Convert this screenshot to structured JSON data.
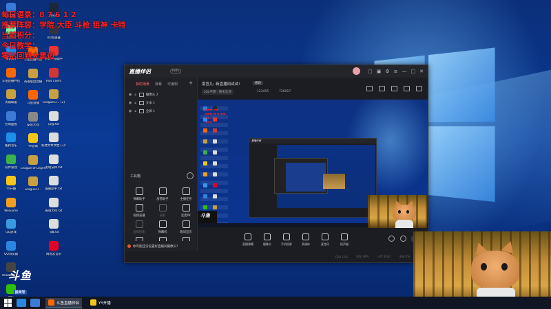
{
  "overlay_text": {
    "line1": "每日语录：8 7 6 1 2",
    "line2": "推荐阵容：学院 大臣 斗枪 狙神 卡特",
    "line3": "当前积分：",
    "line4": "今日教学：",
    "line5": "零钻回到大黑边"
  },
  "desktop_icons": [
    {
      "label": "此电脑",
      "color": "#3a7bd5"
    },
    {
      "label": "回收站",
      "color": "#8fa"
    },
    {
      "label": "腾讯QQ",
      "color": "#1e90ff"
    },
    {
      "label": "斗鱼直播伴侣",
      "color": "#f60"
    },
    {
      "label": "英雄联盟",
      "color": "#c8a040"
    },
    {
      "label": "控制面板",
      "color": "#3d7cd6"
    },
    {
      "label": "酷狗音乐",
      "color": "#1d8fe8"
    },
    {
      "label": "软件管理",
      "color": "#3bb34a"
    },
    {
      "label": "YY开播",
      "color": "#f5c518"
    },
    {
      "label": "WeGame",
      "color": "#f0a020"
    },
    {
      "label": "QQ游戏",
      "color": "#3a9ae0"
    },
    {
      "label": "QQ浏览器",
      "color": "#2a86e0"
    },
    {
      "label": "4Hoab211...",
      "color": "#444"
    },
    {
      "label": "微信",
      "color": "#2dc100"
    }
  ],
  "desktop_icons_col2": [
    {
      "label": "Steam",
      "color": "#1b2838"
    },
    {
      "label": "UU加速器",
      "color": "#334"
    },
    {
      "label": "腾讯手游助手",
      "color": "#e33"
    },
    {
      "label": "Riot Client",
      "color": "#d13639"
    },
    {
      "label": "LeagueCl... (2)",
      "color": "#c8a040"
    },
    {
      "label": "日程.txt",
      "color": "#ddd"
    },
    {
      "label": "新建文本文档 (3).txt",
      "color": "#ddd"
    },
    {
      "label": "黑暗法师.txt",
      "color": "#ddd"
    },
    {
      "label": "国服助手.txt",
      "color": "#ddd"
    },
    {
      "label": "省钱大师.txt",
      "color": "#ddd"
    },
    {
      "label": "飞鹰.txt",
      "color": "#ddd"
    },
    {
      "label": "网易云音乐",
      "color": "#e60026"
    }
  ],
  "desktop_icons_mid": [
    {
      "label": "斗鱼直播伴侣",
      "color": "#f60"
    },
    {
      "label": "英雄联盟直播",
      "color": "#c8a040"
    },
    {
      "label": "斗鱼直播",
      "color": "#f60"
    },
    {
      "label": "安装大师",
      "color": "#888"
    },
    {
      "label": "YY游戏",
      "color": "#f5c518"
    },
    {
      "label": "League of Legends",
      "color": "#c8a040"
    },
    {
      "label": "LeagueCl...",
      "color": "#c8a040"
    }
  ],
  "douyu": {
    "brand": "斗鱼",
    "tag": "房间号",
    "room": "123455"
  },
  "taskbar": {
    "apps": [
      {
        "label": "斗鱼直播伴侣",
        "color": "#f60",
        "active": true
      },
      {
        "label": "YY开播",
        "color": "#f5c518",
        "active": false
      }
    ]
  },
  "app": {
    "logo": "直播伴侣",
    "version": "beta",
    "tabs": [
      "我的场景",
      "弹幕",
      "可编辑"
    ],
    "sources": [
      {
        "label": "摄像头 2"
      },
      {
        "label": "文本 1"
      },
      {
        "label": "全屏 1"
      }
    ],
    "tools_title": "工具箱",
    "tools": [
      {
        "label": "弹幕助手",
        "dim": false
      },
      {
        "label": "房管助手",
        "dim": false
      },
      {
        "label": "主播任务",
        "dim": false
      },
      {
        "label": "视频直播",
        "dim": false
      },
      {
        "label": "录屏",
        "dim": true
      },
      {
        "label": "连麦PK",
        "dim": false
      },
      {
        "label": "虚拟形象",
        "dim": true
      },
      {
        "label": "弹幕机",
        "dim": false
      },
      {
        "label": "歌词显示",
        "dim": false
      },
      {
        "label": "互动玩法",
        "dim": false
      },
      {
        "label": "",
        "dim": false
      },
      {
        "label": "",
        "dim": false
      }
    ],
    "notice": "你可能还没设置好直播间摄像头?",
    "room_title": "南宫儿: 新直播间试试!",
    "modify": "修改",
    "category": "LOL手游 · 快乐云顶",
    "room_id": "123455",
    "popularity": "726017",
    "bottom_tools": [
      "直播弹幕",
      "摄像头",
      "手机投屏",
      "多媒体",
      "麦克风",
      "扬声器"
    ],
    "status": [
      "CPU 12%",
      "内存 48%",
      "上传 0kb/s",
      "丢帧 0%"
    ]
  },
  "colors": {
    "accent_red": "#ff2020",
    "app_bg": "#1c1d22"
  }
}
